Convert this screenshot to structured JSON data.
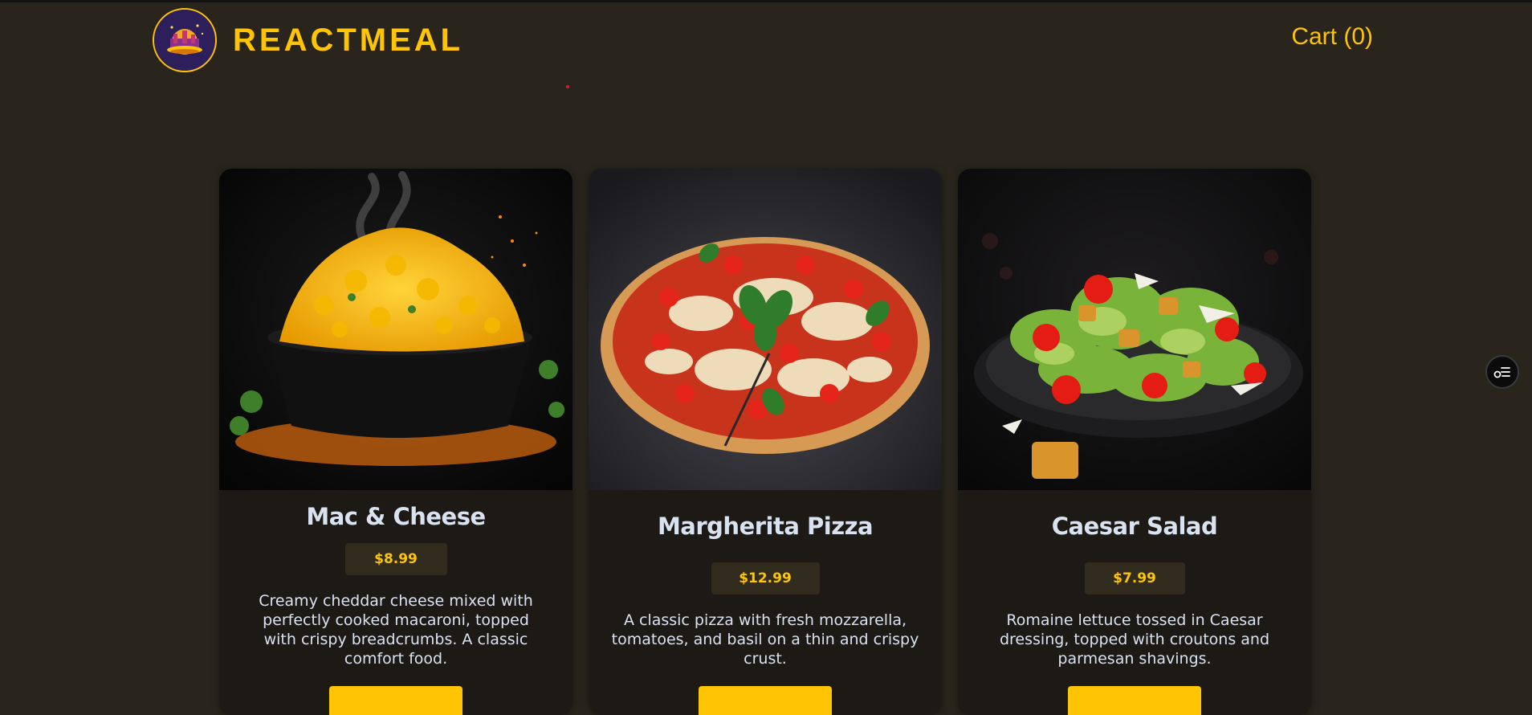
{
  "header": {
    "title": "REACTMEAL",
    "cart_label": "Cart (0)",
    "logo_icon": "restaurant-logo-icon"
  },
  "meals": [
    {
      "name": "Mac & Cheese",
      "price": "$8.99",
      "description": "Creamy cheddar cheese mixed with perfectly cooked macaroni, topped with crispy breadcrumbs. A classic comfort food.",
      "image_icon": "mac-and-cheese-image"
    },
    {
      "name": "Margherita Pizza",
      "price": "$12.99",
      "description": "A classic pizza with fresh mozzarella, tomatoes, and basil on a thin and crispy crust.",
      "image_icon": "margherita-pizza-image"
    },
    {
      "name": "Caesar Salad",
      "price": "$7.99",
      "description": "Romaine lettuce tossed in Caesar dressing, topped with croutons and parmesan shavings.",
      "image_icon": "caesar-salad-image"
    }
  ],
  "floating_button_icon": "menu-toggle-icon",
  "colors": {
    "background": "#29251c",
    "accent": "#ffc404",
    "card": "#1d1a16",
    "text": "#d9e2f1"
  }
}
